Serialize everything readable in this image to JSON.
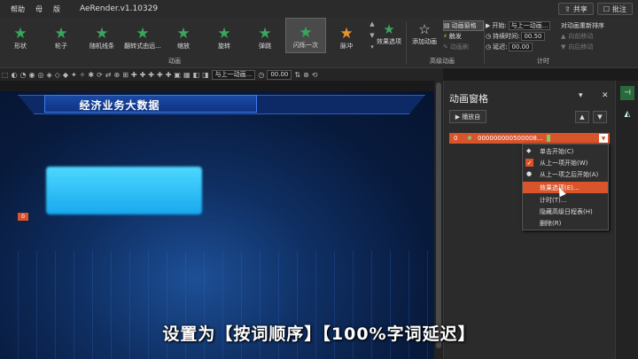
{
  "titlebar": {
    "menu": [
      "帮助",
      "母",
      "版"
    ],
    "title": "AeRender.v1.10329",
    "share": "共享",
    "comment": "批注"
  },
  "ribbon": {
    "effects": [
      {
        "label": "形状",
        "icon": "star-icon"
      },
      {
        "label": "轮子",
        "icon": "star-icon"
      },
      {
        "label": "随机线条",
        "icon": "star-icon"
      },
      {
        "label": "翻转式由远...",
        "icon": "star-icon"
      },
      {
        "label": "缩放",
        "icon": "star-icon"
      },
      {
        "label": "旋转",
        "icon": "star-icon"
      },
      {
        "label": "弹跳",
        "icon": "star-icon"
      },
      {
        "label": "闪烁一次",
        "icon": "star-icon",
        "selected": true
      },
      {
        "label": "脉冲",
        "icon": "star-icon",
        "color": "#e8922b"
      }
    ],
    "group_animation": "动画",
    "effect_options": "效果选项",
    "add_animation": "添加动画",
    "advanced": {
      "pane": "动画窗格",
      "trigger": "触发",
      "painter": "动画刷",
      "group": "高级动画"
    },
    "timing": {
      "start_label": "开始:",
      "start_value": "与上一动画...",
      "duration_label": "持续时间:",
      "duration_value": "00.50",
      "delay_label": "延迟:",
      "delay_value": "00.00",
      "group": "计时"
    },
    "reorder": {
      "title": "对动画重新排序",
      "earlier": "向前移动",
      "later": "向后移动"
    }
  },
  "toolbar": {
    "start_box": "与上一动画...",
    "delay_box": "00.00"
  },
  "slide": {
    "header_title": "经济业务大数据",
    "marker": "0",
    "subtitle": "设置为【按词顺序】【100%字词延迟】"
  },
  "pane": {
    "title": "动画窗格",
    "play": "播放自",
    "item": {
      "number": "0",
      "name": "000000000500008..."
    }
  },
  "context_menu": [
    {
      "label": "单击开始(C)",
      "icon": "mouse-icon"
    },
    {
      "label": "从上一项开始(W)",
      "checked": true
    },
    {
      "label": "从上一项之后开始(A)",
      "icon": "clock-icon"
    },
    {
      "label": "效果选项(E)...",
      "highlighted": true
    },
    {
      "label": "计时(T)..."
    },
    {
      "label": "隐藏高级日程表(H)"
    },
    {
      "label": "删除(R)"
    }
  ],
  "colors": {
    "accent": "#d9532b",
    "green_star": "#3aa55c"
  }
}
